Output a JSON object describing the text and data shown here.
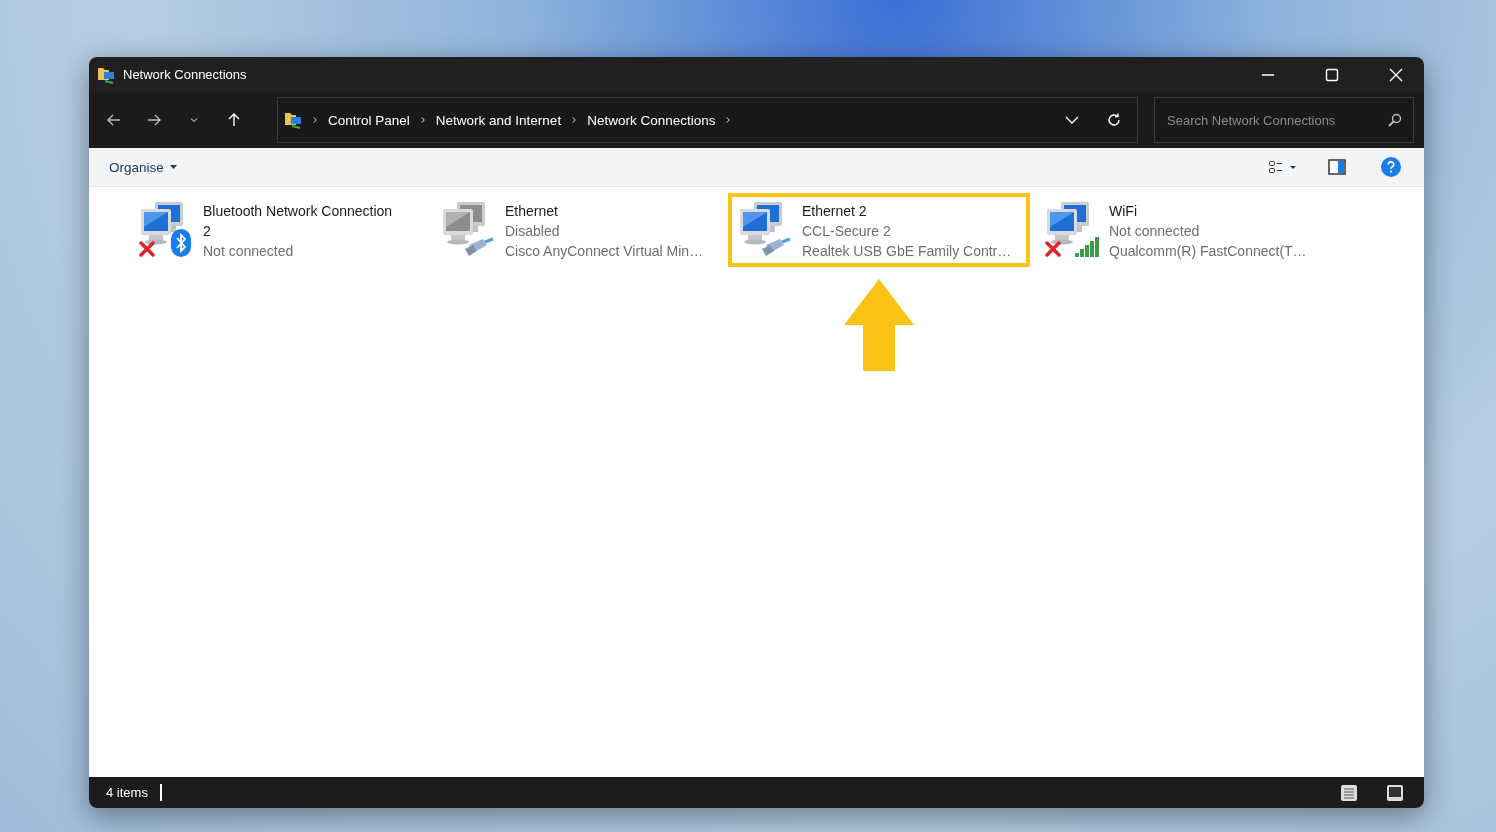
{
  "window": {
    "title": "Network Connections"
  },
  "address_bar": {
    "breadcrumbs": [
      "Control Panel",
      "Network and Internet",
      "Network Connections"
    ]
  },
  "search": {
    "placeholder": "Search Network Connections"
  },
  "toolbar": {
    "organise": "Organise"
  },
  "connections": [
    {
      "kind": "bluetooth",
      "name": "Bluetooth Network Connection 2",
      "status": "Not connected",
      "connected": false,
      "disabled": false,
      "highlighted": false
    },
    {
      "kind": "ethernet",
      "name": "Ethernet",
      "status": "Disabled",
      "device": "Cisco AnyConnect Virtual Min…",
      "connected": true,
      "disabled": true,
      "highlighted": false
    },
    {
      "kind": "ethernet",
      "name": "Ethernet 2",
      "status": "CCL-Secure 2",
      "device": "Realtek USB GbE Family Contr…",
      "connected": true,
      "disabled": false,
      "highlighted": true
    },
    {
      "kind": "wifi",
      "name": "WiFi",
      "status": "Not connected",
      "device": "Qualcomm(R) FastConnect(T…",
      "connected": false,
      "disabled": false,
      "highlighted": false
    }
  ],
  "status_bar": {
    "count": "4 items"
  }
}
